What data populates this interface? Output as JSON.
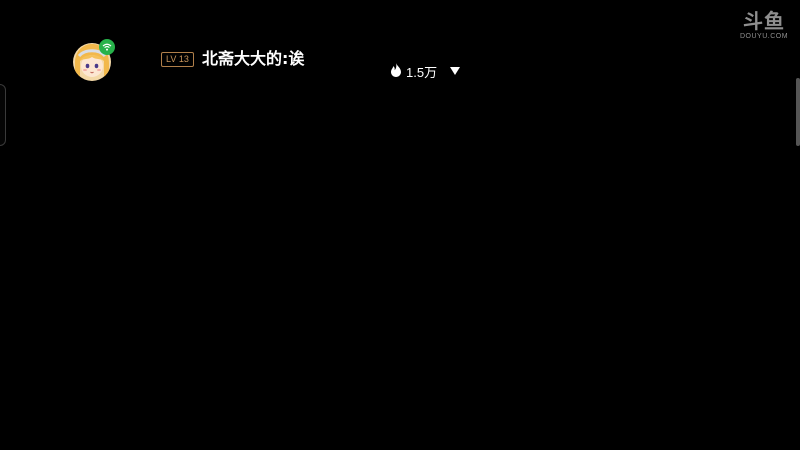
{
  "stream": {
    "user": {
      "level": "LV 13",
      "name": "北斋大大的:诶"
    },
    "popularity": {
      "value": "1.5万"
    }
  },
  "watermark": {
    "brand_cn": "斗鱼",
    "brand_en": "DOUYU.COM"
  },
  "icons": {
    "avatar": "avatar-anime-girl",
    "online_badge": "wifi-icon",
    "heat": "flame-icon",
    "menu": "triangle-down-icon"
  },
  "colors": {
    "background": "#000000",
    "level_badge": "#c8955b",
    "online_badge": "#27b24a",
    "text": "#ffffff"
  }
}
